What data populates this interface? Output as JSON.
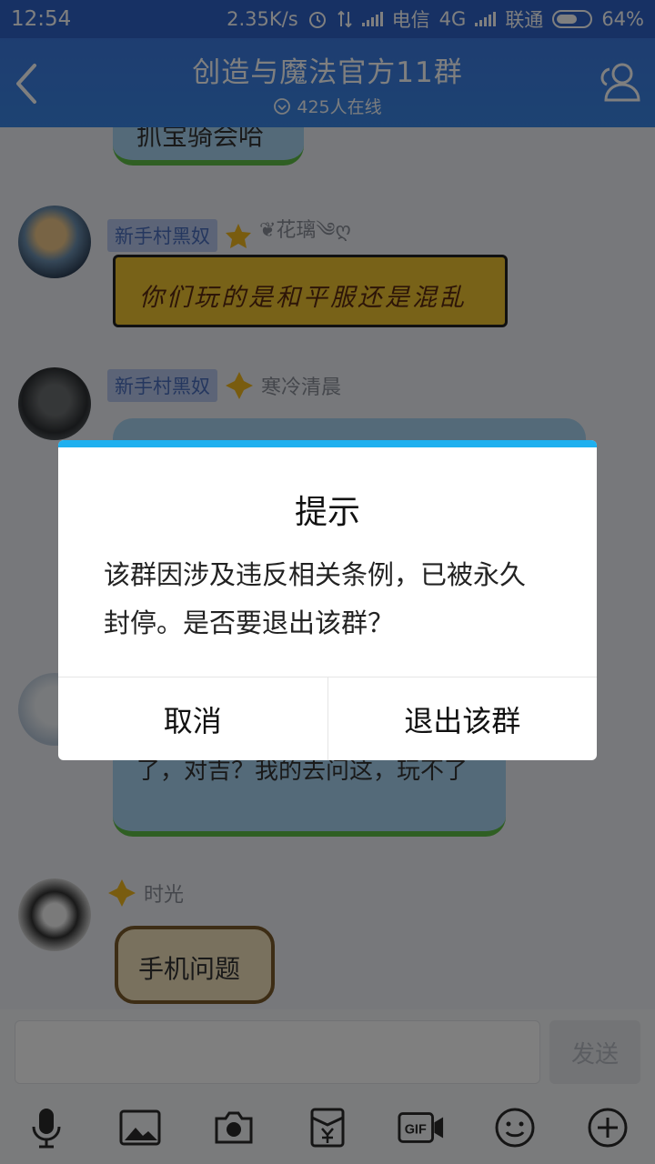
{
  "status_bar": {
    "time": "12:54",
    "speed": "2.35K/s",
    "carrier1": "电信",
    "net1": "4G",
    "carrier2": "联通",
    "battery": "64%",
    "battery_level": 0.64
  },
  "header": {
    "title": "创造与魔法官方11群",
    "online": "425人在线"
  },
  "messages": [
    {
      "text": "抓宝骑会哈"
    },
    {
      "rank": "新手村黑奴",
      "name": "❦花璃༄ღ",
      "text": "你们玩的是和平服还是混乱"
    },
    {
      "rank": "新手村黑奴",
      "name": "寒冷清晨",
      "text": ""
    },
    {
      "text": "了，对吉？我的去问这，玩不了"
    },
    {
      "name": "时光",
      "text": "手机问题"
    }
  ],
  "input": {
    "placeholder": "",
    "send_label": "发送"
  },
  "toolbar": {
    "icons": [
      "microphone-icon",
      "image-icon",
      "camera-icon",
      "red-packet-icon",
      "gif-icon",
      "emoji-icon",
      "plus-icon"
    ]
  },
  "dialog": {
    "title": "提示",
    "body": "该群因涉及违反相关条例，已被永久封停。是否要退出该群？",
    "cancel": "取消",
    "confirm": "退出该群"
  },
  "colors": {
    "header_bg": "#3a82e4",
    "dialog_accent": "#1fb0ef"
  }
}
